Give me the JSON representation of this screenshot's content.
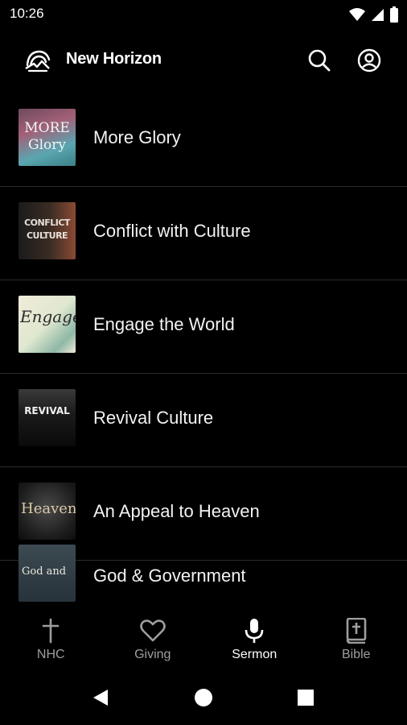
{
  "status": {
    "time": "10:26",
    "icons": [
      "wifi-icon",
      "signal-icon",
      "battery-icon"
    ]
  },
  "app": {
    "title": "New Horizon",
    "logo_icon": "new-horizon-logo"
  },
  "colors": {
    "background": "#000000",
    "text": "#ffffff",
    "inactive": "#9e9e9e",
    "divider": "#2a2a2a"
  },
  "sermons": [
    {
      "title": "More Glory",
      "thumb_text": "MORE Glory"
    },
    {
      "title": "Conflict with Culture",
      "thumb_text": "CONFLICT CULTURE"
    },
    {
      "title": "Engage the World",
      "thumb_text": "Engage"
    },
    {
      "title": "Revival Culture",
      "thumb_text": "REVIVAL"
    },
    {
      "title": "An Appeal to Heaven",
      "thumb_text": "Heaven"
    },
    {
      "title": "God & Government",
      "thumb_text": "God and"
    }
  ],
  "nav": [
    {
      "label": "NHC",
      "icon": "cross-icon",
      "active": false
    },
    {
      "label": "Giving",
      "icon": "heart-icon",
      "active": false
    },
    {
      "label": "Sermon",
      "icon": "microphone-icon",
      "active": true
    },
    {
      "label": "Bible",
      "icon": "bible-icon",
      "active": false
    }
  ]
}
